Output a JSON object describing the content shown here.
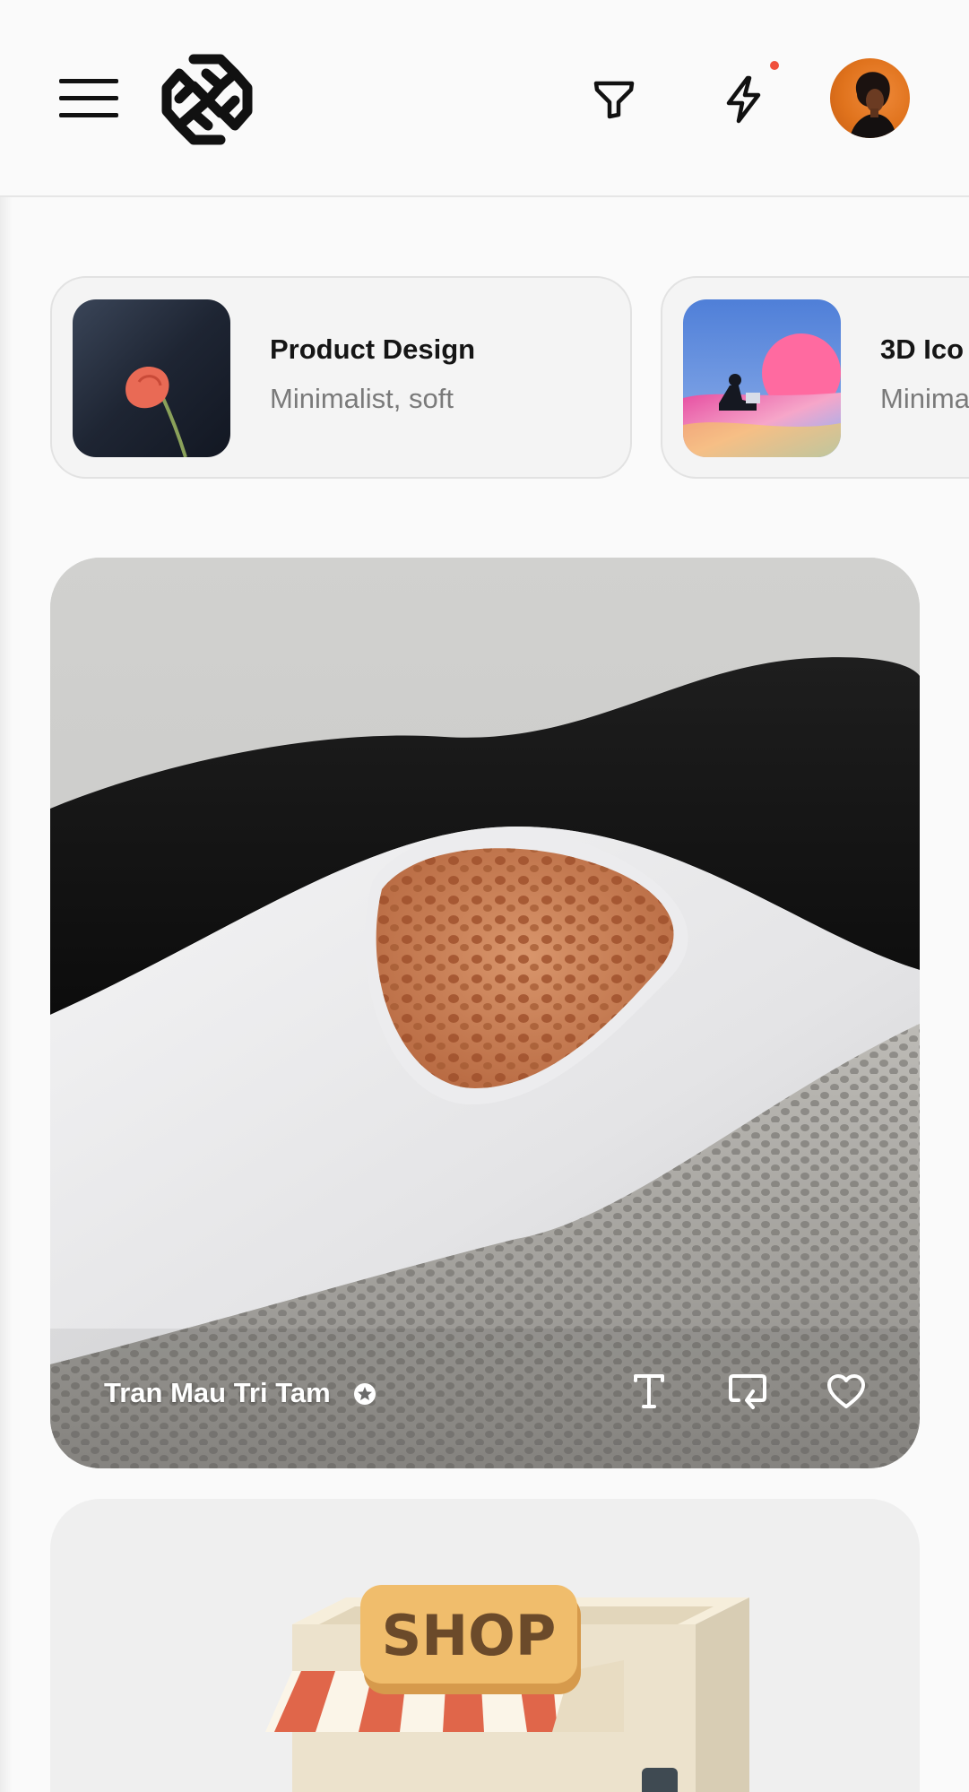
{
  "header": {
    "menu_icon": "hamburger-menu-icon",
    "logo_icon": "geometric-knot-logo",
    "filter_icon": "filter-funnel-icon",
    "activity_icon": "lightning-bolt-icon",
    "notification_color": "#f0503c",
    "avatar_color": "#e0731d"
  },
  "categories": [
    {
      "title": "Product Design",
      "subtitle": "Minimalist, soft"
    },
    {
      "title": "3D Ico",
      "subtitle": "Minima"
    }
  ],
  "feed": {
    "cards": [
      {
        "author": "Tran Mau Tri Tam",
        "verified_icon": "verified-star-badge-icon",
        "actions": [
          "text-prompt-icon",
          "remix-icon",
          "heart-icon"
        ]
      },
      {
        "sign_text": "SHOP"
      }
    ]
  },
  "colors": {
    "background": "#fafafa",
    "chip_background": "#f4f4f4",
    "title_text": "#151515",
    "subtitle_text": "#7a7a7a",
    "awning_red": "#e0664a"
  }
}
